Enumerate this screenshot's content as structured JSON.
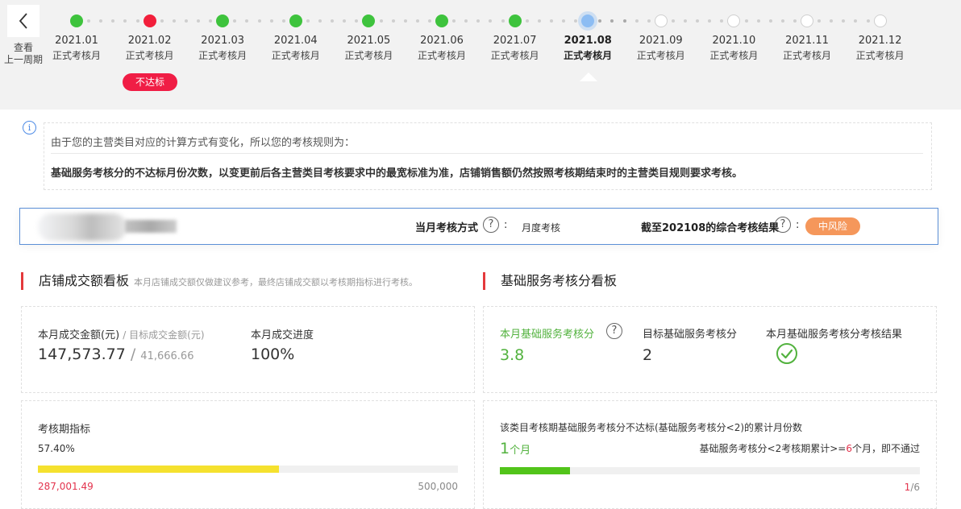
{
  "nav": {
    "back_label_line1": "查看",
    "back_label_line2": "上一周期"
  },
  "timeline": {
    "months": [
      {
        "date": "2021.01",
        "sub": "正式考核月",
        "status": "ok"
      },
      {
        "date": "2021.02",
        "sub": "正式考核月",
        "status": "bad",
        "badge": "不达标"
      },
      {
        "date": "2021.03",
        "sub": "正式考核月",
        "status": "ok"
      },
      {
        "date": "2021.04",
        "sub": "正式考核月",
        "status": "ok"
      },
      {
        "date": "2021.05",
        "sub": "正式考核月",
        "status": "ok"
      },
      {
        "date": "2021.06",
        "sub": "正式考核月",
        "status": "ok"
      },
      {
        "date": "2021.07",
        "sub": "正式考核月",
        "status": "ok"
      },
      {
        "date": "2021.08",
        "sub": "正式考核月",
        "status": "current"
      },
      {
        "date": "2021.09",
        "sub": "正式考核月",
        "status": "future"
      },
      {
        "date": "2021.10",
        "sub": "正式考核月",
        "status": "future"
      },
      {
        "date": "2021.11",
        "sub": "正式考核月",
        "status": "future"
      },
      {
        "date": "2021.12",
        "sub": "正式考核月",
        "status": "future"
      }
    ]
  },
  "notice": {
    "icon": "info-icon",
    "line1": "由于您的主营类目对应的计算方式有变化，所以您的考核规则为：",
    "line2": "基础服务考核分的不达标月份次数，以变更前后各主营类目考核要求中的最宽标准为准，店铺销售额仍然按照考核期结束时的主营类目规则要求考核。"
  },
  "store": {
    "method_label": "当月考核方式",
    "method_value": "月度考核",
    "result_label": "截至202108的综合考核结果",
    "result_value": "中风险",
    "colon": ":"
  },
  "sales_board": {
    "title": "店铺成交额看板",
    "subtitle": "本月店铺成交额仅做建议参考，最终店铺成交额以考核期指标进行考核。",
    "amount_label": "本月成交金额(元)",
    "target_label": "目标成交金额(元)",
    "amount_value": "147,573.77",
    "target_value": "41,666.66",
    "slash": "/",
    "progress_label": "本月成交进度",
    "progress_value": "100%",
    "period_label": "考核期指标",
    "period_percent": "57.40%",
    "period_fraction": 0.574,
    "period_current": "287,001.49",
    "period_target": "500,000",
    "bar_color": "#f5e12e"
  },
  "service_board": {
    "title": "基础服务考核分看板",
    "score_label": "本月基础服务考核分",
    "score_value": "3.8",
    "target_label": "目标基础服务考核分",
    "target_value": "2",
    "result_label": "本月基础服务考核分考核结果",
    "result_icon": "check-circle-icon",
    "cumulative_label": "该类目考核期基础服务考核分不达标(基础服务考核分<2)的累计月份数",
    "cumulative_num": "1",
    "cumulative_unit": "个月",
    "rule_prefix": "基础服务考核分<2考核期累计>=",
    "rule_num": "6",
    "rule_suffix": "个月，即不通过",
    "bar_fraction": 0.1667,
    "bar_color": "#52c41a",
    "count_num": "1",
    "count_total": "/6"
  },
  "colors": {
    "ok": "#3ec33d",
    "bad": "#f21f3b",
    "current": "#8dbdf3",
    "risk": "#f5975b",
    "accent_red": "#e3334d"
  }
}
